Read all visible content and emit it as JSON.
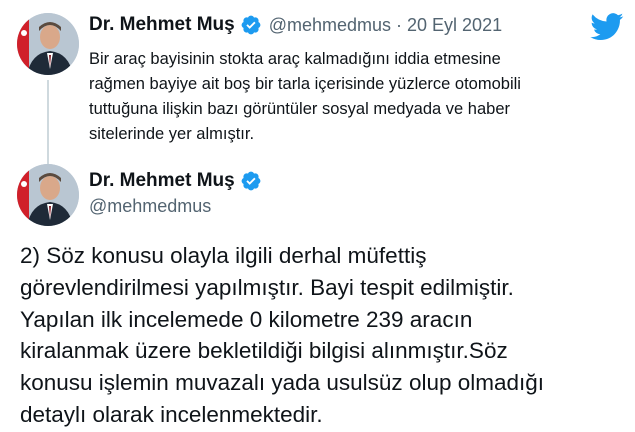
{
  "colors": {
    "accent": "#1d9bf0",
    "text": "#0f1419",
    "muted": "#536471",
    "thread_line": "#cfd9de"
  },
  "quoted_tweet": {
    "author_name": "Dr. Mehmet Muş",
    "handle": "@mehmedmus",
    "separator": "·",
    "date": "20 Eyl 2021",
    "text_lines": [
      "Bir araç bayisinin stokta araç kalmadığını iddia etmesine",
      "rağmen bayiye ait boş bir tarla içerisinde yüzlerce otomobili",
      "tuttuğuna ilişkin bazı görüntüler sosyal medyada ve haber",
      "sitelerinde yer almıştır."
    ]
  },
  "main_tweet": {
    "author_name": "Dr. Mehmet Muş",
    "handle": "@mehmedmus",
    "text_lines": [
      "2) Söz konusu olayla ilgili derhal müfettiş",
      "görevlendirilmesi yapılmıştır. Bayi tespit edilmiştir.",
      "Yapılan ilk incelemede 0 kilometre 239 aracın",
      "kiralanmak üzere bekletildiği bilgisi alınmıştır.Söz",
      "konusu işlemin muvazalı yada usulsüz olup olmadığı",
      "detaylı olarak incelenmektedir."
    ]
  },
  "icons": {
    "verified": "verified-badge-icon",
    "brand": "twitter-bird-icon"
  }
}
